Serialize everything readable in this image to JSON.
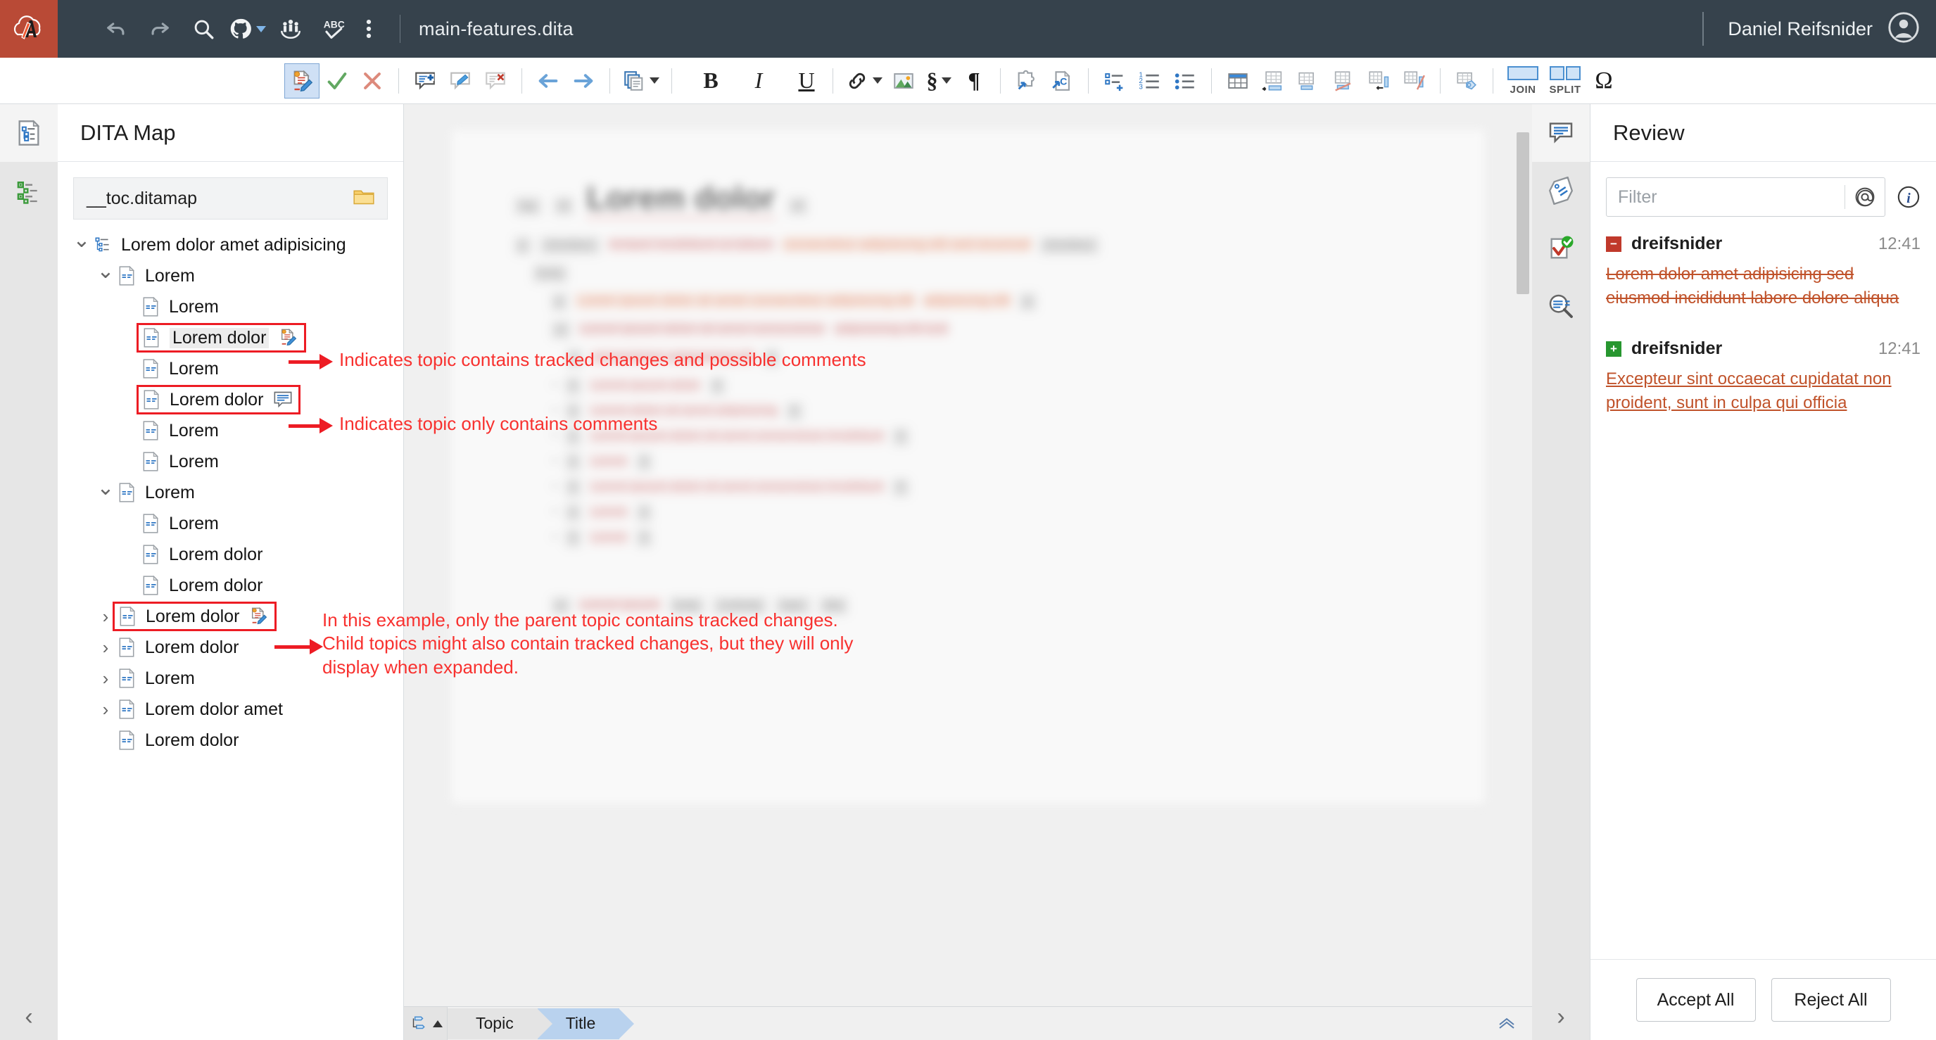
{
  "topbar": {
    "logo": "oxygen-cloud-logo",
    "document_title": "main-features.dita",
    "user_name": "Daniel Reifsnider",
    "tools": [
      {
        "name": "undo-icon",
        "label": "Undo"
      },
      {
        "name": "redo-icon",
        "label": "Redo"
      },
      {
        "name": "search-icon",
        "label": "Search"
      },
      {
        "name": "github-icon",
        "label": "GitHub"
      },
      {
        "name": "team-icon",
        "label": "Team"
      },
      {
        "name": "spellcheck-icon",
        "label": "Spell Check"
      },
      {
        "name": "more-options-icon",
        "label": "More"
      }
    ]
  },
  "formatbar": {
    "items": [
      {
        "name": "track-changes-toggle",
        "label": "Track Changes"
      },
      {
        "name": "accept-change-button",
        "label": "Accept Change"
      },
      {
        "name": "reject-change-button",
        "label": "Reject Change"
      },
      {
        "name": "add-comment-button",
        "label": "Add Comment"
      },
      {
        "name": "edit-comment-button",
        "label": "Edit Comment"
      },
      {
        "name": "remove-comment-button",
        "label": "Remove Comment"
      },
      {
        "name": "previous-change-button",
        "label": "Previous Change"
      },
      {
        "name": "next-change-button",
        "label": "Next Change"
      },
      {
        "name": "paste-special-button",
        "label": "Paste Special"
      },
      {
        "name": "bold-button",
        "label": "B"
      },
      {
        "name": "italic-button",
        "label": "I"
      },
      {
        "name": "underline-button",
        "label": "U"
      },
      {
        "name": "link-button",
        "label": "Insert Link"
      },
      {
        "name": "image-button",
        "label": "Insert Image"
      },
      {
        "name": "section-button",
        "label": "§"
      },
      {
        "name": "paragraph-button",
        "label": "¶"
      },
      {
        "name": "insert-content-reference-button",
        "label": "Insert Content Reference"
      },
      {
        "name": "insert-conref-button",
        "label": "Insert Conref"
      },
      {
        "name": "definition-list-button",
        "label": "Definition List"
      },
      {
        "name": "ordered-list-button",
        "label": "Ordered List"
      },
      {
        "name": "unordered-list-button",
        "label": "Unordered List"
      },
      {
        "name": "insert-table-button",
        "label": "Insert Table"
      },
      {
        "name": "insert-row-above-button",
        "label": "Insert Row Above"
      },
      {
        "name": "insert-row-below-button",
        "label": "Insert Row Below"
      },
      {
        "name": "delete-row-button",
        "label": "Delete Row"
      },
      {
        "name": "insert-column-button",
        "label": "Insert Column"
      },
      {
        "name": "delete-column-button",
        "label": "Delete Column"
      },
      {
        "name": "table-properties-button",
        "label": "Table Properties"
      },
      {
        "name": "join-cells-button",
        "label": "JOIN"
      },
      {
        "name": "split-cells-button",
        "label": "SPLIT"
      },
      {
        "name": "special-character-button",
        "label": "Ω"
      }
    ],
    "join_label": "JOIN",
    "split_label": "SPLIT"
  },
  "left_rail": {
    "items": [
      {
        "name": "rail-item-dita-map",
        "label": "DITA Map",
        "selected": true
      },
      {
        "name": "rail-item-outline",
        "label": "Outline",
        "selected": false
      }
    ],
    "collapse_glyph": "‹"
  },
  "dita_map": {
    "title": "DITA Map",
    "file_name": "__toc.ditamap",
    "folder_icon": "folder-icon",
    "tree": [
      {
        "label": "Lorem dolor amet adipisicing",
        "indent": 0,
        "twisty": "down",
        "icon": "map-icon",
        "badge": null,
        "marked": false,
        "highlight": false
      },
      {
        "label": "Lorem",
        "indent": 1,
        "twisty": "down",
        "icon": "topic-icon",
        "badge": null,
        "marked": false,
        "highlight": false
      },
      {
        "label": "Lorem",
        "indent": 2,
        "twisty": "none",
        "icon": "topic-icon",
        "badge": null,
        "marked": false,
        "highlight": false
      },
      {
        "label": "Lorem dolor",
        "indent": 2,
        "twisty": "none",
        "icon": "topic-icon",
        "badge": "tracked-changes-icon",
        "marked": true,
        "highlight": true
      },
      {
        "label": "Lorem",
        "indent": 2,
        "twisty": "none",
        "icon": "topic-icon",
        "badge": null,
        "marked": false,
        "highlight": false
      },
      {
        "label": "Lorem dolor",
        "indent": 2,
        "twisty": "none",
        "icon": "topic-icon",
        "badge": "comment-icon",
        "marked": true,
        "highlight": false
      },
      {
        "label": "Lorem",
        "indent": 2,
        "twisty": "none",
        "icon": "topic-icon",
        "badge": null,
        "marked": false,
        "highlight": false
      },
      {
        "label": "Lorem",
        "indent": 2,
        "twisty": "none",
        "icon": "topic-icon",
        "badge": null,
        "marked": false,
        "highlight": false
      },
      {
        "label": "Lorem",
        "indent": 1,
        "twisty": "down",
        "icon": "topic-icon",
        "badge": null,
        "marked": false,
        "highlight": false
      },
      {
        "label": "Lorem",
        "indent": 2,
        "twisty": "none",
        "icon": "topic-icon",
        "badge": null,
        "marked": false,
        "highlight": false
      },
      {
        "label": "Lorem dolor",
        "indent": 2,
        "twisty": "none",
        "icon": "topic-icon",
        "badge": null,
        "marked": false,
        "highlight": false
      },
      {
        "label": "Lorem dolor",
        "indent": 2,
        "twisty": "none",
        "icon": "topic-icon",
        "badge": null,
        "marked": false,
        "highlight": false
      },
      {
        "label": "Lorem dolor",
        "indent": 1,
        "twisty": "right",
        "icon": "topic-icon",
        "badge": "tracked-changes-icon",
        "marked": true,
        "highlight": false
      },
      {
        "label": "Lorem dolor",
        "indent": 1,
        "twisty": "right",
        "icon": "topic-icon",
        "badge": null,
        "marked": false,
        "highlight": false
      },
      {
        "label": "Lorem",
        "indent": 1,
        "twisty": "right",
        "icon": "topic-icon",
        "badge": null,
        "marked": false,
        "highlight": false
      },
      {
        "label": "Lorem dolor amet",
        "indent": 1,
        "twisty": "right",
        "icon": "topic-icon",
        "badge": null,
        "marked": false,
        "highlight": false
      },
      {
        "label": "Lorem dolor",
        "indent": 1,
        "twisty": "none",
        "icon": "topic-icon",
        "badge": null,
        "marked": false,
        "highlight": false
      }
    ]
  },
  "annotations": [
    {
      "name": "annotation-tracked-changes",
      "text": "Indicates topic contains tracked changes and possible comments"
    },
    {
      "name": "annotation-comments-only",
      "text": "Indicates topic only contains comments"
    },
    {
      "name": "annotation-parent-topic",
      "text": "In this example, only the parent topic contains tracked changes.\nChild topics might also contain tracked changes, but they will only\ndisplay when expanded."
    }
  ],
  "editor": {
    "document_heading": "Lorem dolor",
    "ghost_tags": {
      "t1": "tag",
      "t2": "id",
      "t3": "el",
      "t4": "p",
      "t5": "li"
    },
    "ghost_ins": "consectetur adipisicing elit sed eiusmod",
    "ghost_del": "tempor incididunt ut labore",
    "ghost_text": "Lorem ipsum dolor sit amet consectetur adipisicing elit"
  },
  "breadcrumb": {
    "toggle_icon": "element-structure-icon",
    "items": [
      {
        "label": "Topic",
        "selected": false
      },
      {
        "label": "Title",
        "selected": true
      }
    ],
    "collapse_glyph": "«"
  },
  "right_rail": {
    "items": [
      {
        "name": "rail-item-review",
        "label": "Review",
        "selected": true
      },
      {
        "name": "rail-item-attributes",
        "label": "Attributes",
        "selected": false
      },
      {
        "name": "rail-item-validation",
        "label": "Validation",
        "selected": false
      },
      {
        "name": "rail-item-find-replace",
        "label": "Find/Replace",
        "selected": false
      }
    ],
    "collapse_glyph": "›"
  },
  "review": {
    "title": "Review",
    "filter_placeholder": "Filter",
    "filter_value": "",
    "mention_icon": "at-icon",
    "info_icon": "info-icon",
    "entries": [
      {
        "kind": "deletion",
        "marker": "−",
        "author": "dreifsnider",
        "time": "12:41",
        "text": "Lorem dolor amet adipisicing sed eiusmod incididunt labore dolore aliqua"
      },
      {
        "kind": "insertion",
        "marker": "+",
        "author": "dreifsnider",
        "time": "12:41",
        "text": "Excepteur sint occaecat cupidatat non proident, sunt in culpa qui officia "
      }
    ],
    "accept_all_label": "Accept All",
    "reject_all_label": "Reject All"
  },
  "colors": {
    "topbar_bg": "#36424c",
    "logo_bg": "#b94a36",
    "annotation_red": "#f8312f",
    "marker_red": "#ed1c24",
    "deletion_orange": "#c0522a",
    "insertion_green": "#27962f",
    "selected_crumb": "#b9d2ee"
  }
}
